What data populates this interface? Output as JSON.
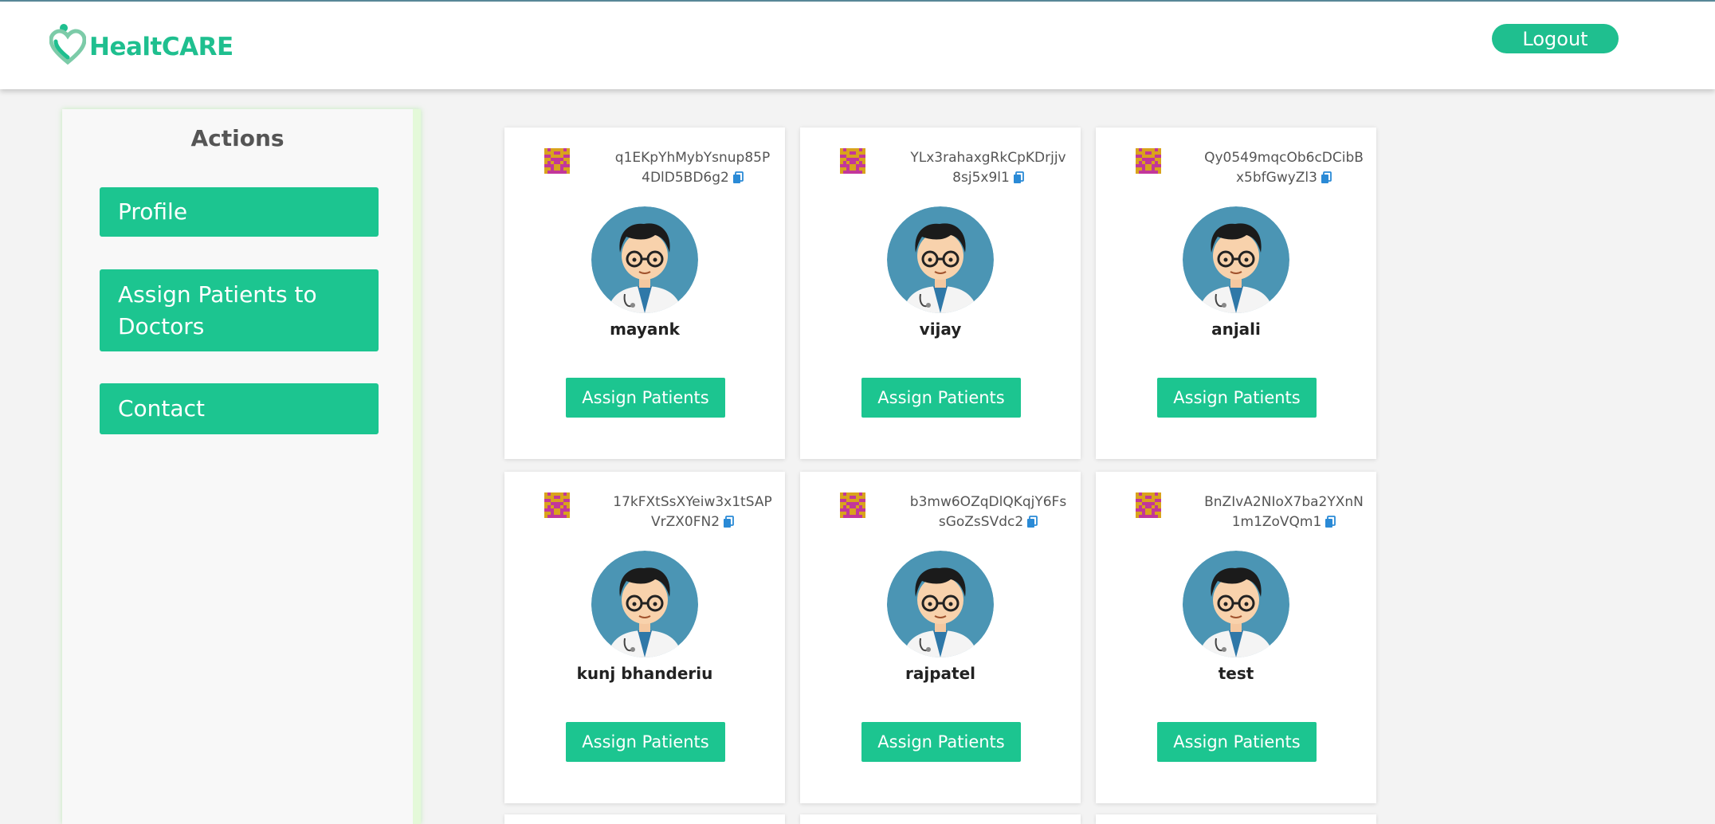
{
  "brand": {
    "name": "HealtCARE"
  },
  "header": {
    "logout_label": "Logout"
  },
  "sidebar": {
    "title": "Actions",
    "items": [
      {
        "label": "Profile"
      },
      {
        "label": "Assign Patients to Doctors"
      },
      {
        "label": "Contact"
      }
    ]
  },
  "doctors": [
    {
      "id": "q1EKpYhMybYsnup85P4DlD5BD6g2",
      "name": "mayank",
      "button": "Assign Patients"
    },
    {
      "id": "YLx3rahaxgRkCpKDrjjv8sj5x9l1",
      "name": "vijay",
      "button": "Assign Patients"
    },
    {
      "id": "Qy0549mqcOb6cDCibBx5bfGwyZl3",
      "name": "anjali",
      "button": "Assign Patients"
    },
    {
      "id": "17kFXtSsXYeiw3x1tSAPVrZX0FN2",
      "name": "kunj bhanderiu",
      "button": "Assign Patients"
    },
    {
      "id": "b3mw6OZqDlQKqjY6FssGoZsSVdc2",
      "name": "rajpatel",
      "button": "Assign Patients"
    },
    {
      "id": "BnZIvA2NIoX7ba2YXnN1m1ZoVQm1",
      "name": "test",
      "button": "Assign Patients"
    }
  ],
  "colors": {
    "accent": "#1cc590",
    "brand": "#1fbf8f",
    "avatar_bg": "#4b95b4"
  },
  "icons": {
    "logo": "heart-person-icon",
    "copy": "copy-icon",
    "identicon": "identicon-icon"
  }
}
